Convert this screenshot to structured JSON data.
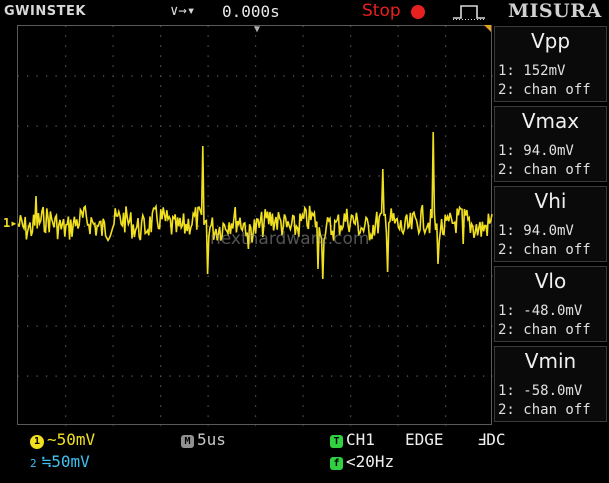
{
  "header": {
    "brand": "GWINSTEK",
    "trigger_indicator": "∨→▾",
    "time_offset": "0.000s",
    "run_status": "Stop",
    "mode_label": "MISURA"
  },
  "screen": {
    "ch1_marker": "1▸",
    "trigger_marker": "▼",
    "watermark": "nexthardware.com"
  },
  "measurements": [
    {
      "title": "Vpp",
      "ch1": "1: 152mV",
      "ch2": "2: chan off"
    },
    {
      "title": "Vmax",
      "ch1": "1: 94.0mV",
      "ch2": "2: chan off"
    },
    {
      "title": "Vhi",
      "ch1": "1: 94.0mV",
      "ch2": "2: chan off"
    },
    {
      "title": "Vlo",
      "ch1": "1: -48.0mV",
      "ch2": "2: chan off"
    },
    {
      "title": "Vmin",
      "ch1": "1: -58.0mV",
      "ch2": "2: chan off"
    }
  ],
  "status": {
    "ch1_badge": "1",
    "ch1_scale": "∼50mV",
    "ch2_badge": "2",
    "ch2_scale": "≒50mV",
    "timebase_badge": "M",
    "timebase": "5us",
    "trigger_badge": "T",
    "trigger_source": "CH1",
    "trigger_type": "EDGE",
    "trigger_coupling": "ℲDC",
    "freq_badge": "f",
    "frequency": "<20Hz"
  },
  "colors": {
    "trace": "#f0e020",
    "ch2": "#40c0f0",
    "stop": "#e82020",
    "badge_green": "#30d040",
    "badge_gray": "#909090",
    "grid_dots": "#6a6a6a"
  }
}
